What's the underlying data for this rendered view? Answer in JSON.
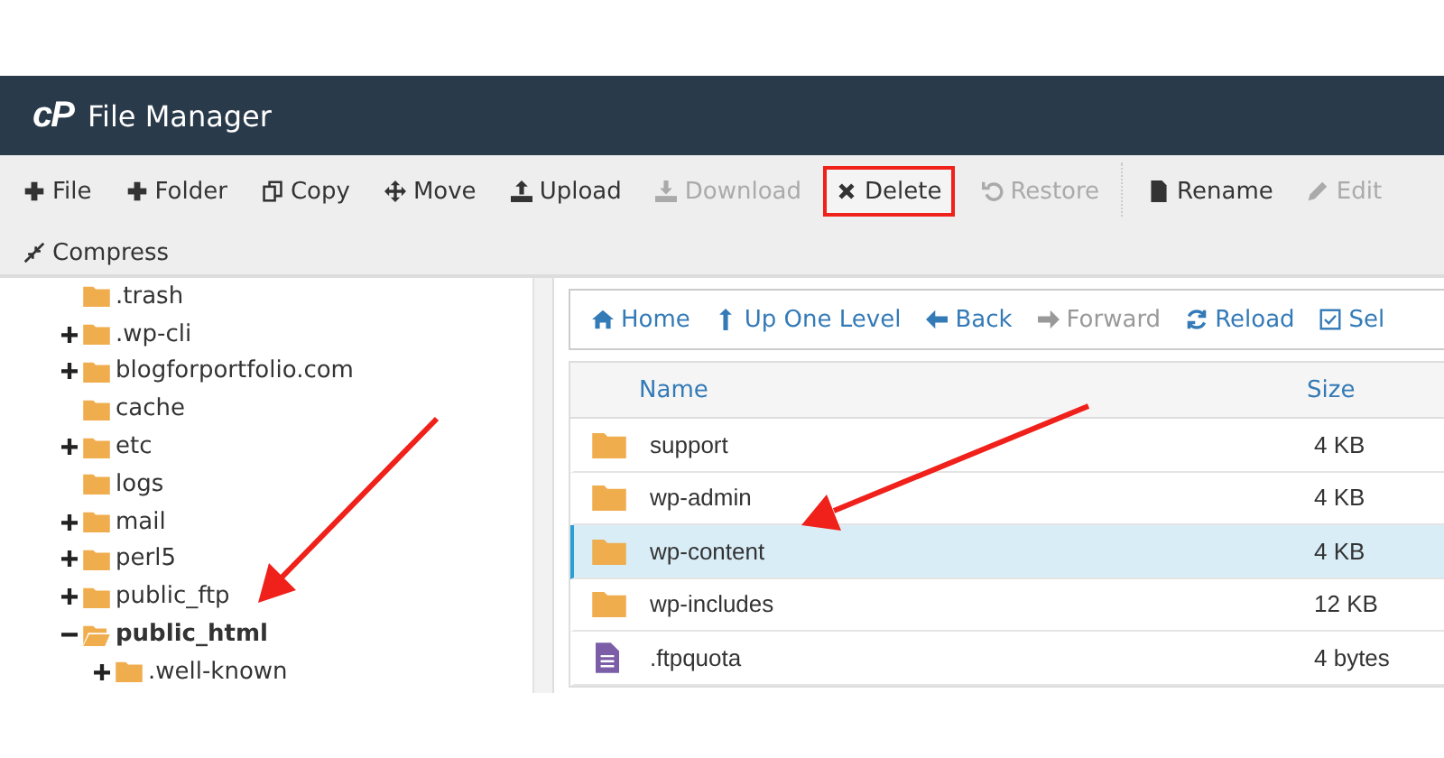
{
  "header": {
    "logo": "cP",
    "title": "File Manager"
  },
  "toolbar": [
    {
      "kind": "plus",
      "label": "File",
      "disabled": false,
      "highlighted": false
    },
    {
      "kind": "plus",
      "label": "Folder",
      "disabled": false,
      "highlighted": false
    },
    {
      "kind": "copy",
      "label": "Copy",
      "disabled": false,
      "highlighted": false
    },
    {
      "kind": "move",
      "label": "Move",
      "disabled": false,
      "highlighted": false
    },
    {
      "kind": "upload",
      "label": "Upload",
      "disabled": false,
      "highlighted": false
    },
    {
      "kind": "download",
      "label": "Download",
      "disabled": true,
      "highlighted": false
    },
    {
      "kind": "delete",
      "label": "Delete",
      "disabled": false,
      "highlighted": true
    },
    {
      "kind": "restore",
      "label": "Restore",
      "disabled": true,
      "highlighted": false
    },
    {
      "kind": "rename",
      "label": "Rename",
      "disabled": false,
      "highlighted": false
    },
    {
      "kind": "edit",
      "label": "Edit",
      "disabled": true,
      "highlighted": false
    },
    {
      "kind": "compress",
      "label": "Compress",
      "disabled": false,
      "highlighted": false
    }
  ],
  "tree": [
    {
      "label": ".trash",
      "expandable": false,
      "expanded": false,
      "selected": false
    },
    {
      "label": ".wp-cli",
      "expandable": true,
      "expanded": false,
      "selected": false
    },
    {
      "label": "blogforportfolio.com",
      "expandable": true,
      "expanded": false,
      "selected": false
    },
    {
      "label": "cache",
      "expandable": false,
      "expanded": false,
      "selected": false
    },
    {
      "label": "etc",
      "expandable": true,
      "expanded": false,
      "selected": false
    },
    {
      "label": "logs",
      "expandable": false,
      "expanded": false,
      "selected": false
    },
    {
      "label": "mail",
      "expandable": true,
      "expanded": false,
      "selected": false
    },
    {
      "label": "perl5",
      "expandable": true,
      "expanded": false,
      "selected": false
    },
    {
      "label": "public_ftp",
      "expandable": true,
      "expanded": false,
      "selected": false
    },
    {
      "label": "public_html",
      "expandable": true,
      "expanded": true,
      "selected": true,
      "children": [
        {
          "label": ".well-known",
          "expandable": true,
          "expanded": false,
          "selected": false
        }
      ]
    }
  ],
  "nav": [
    {
      "kind": "home",
      "label": "Home",
      "disabled": false
    },
    {
      "kind": "up",
      "label": "Up One Level",
      "disabled": false
    },
    {
      "kind": "back",
      "label": "Back",
      "disabled": false
    },
    {
      "kind": "forward",
      "label": "Forward",
      "disabled": true
    },
    {
      "kind": "reload",
      "label": "Reload",
      "disabled": false
    },
    {
      "kind": "select",
      "label": "Sel",
      "disabled": false
    }
  ],
  "table": {
    "columns": [
      "Name",
      "Size"
    ],
    "rows": [
      {
        "kind": "folder",
        "name": "support",
        "size": "4 KB",
        "selected": false
      },
      {
        "kind": "folder",
        "name": "wp-admin",
        "size": "4 KB",
        "selected": false
      },
      {
        "kind": "folder",
        "name": "wp-content",
        "size": "4 KB",
        "selected": true
      },
      {
        "kind": "folder",
        "name": "wp-includes",
        "size": "12 KB",
        "selected": false
      },
      {
        "kind": "file",
        "name": ".ftpquota",
        "size": "4 bytes",
        "selected": false
      }
    ]
  }
}
